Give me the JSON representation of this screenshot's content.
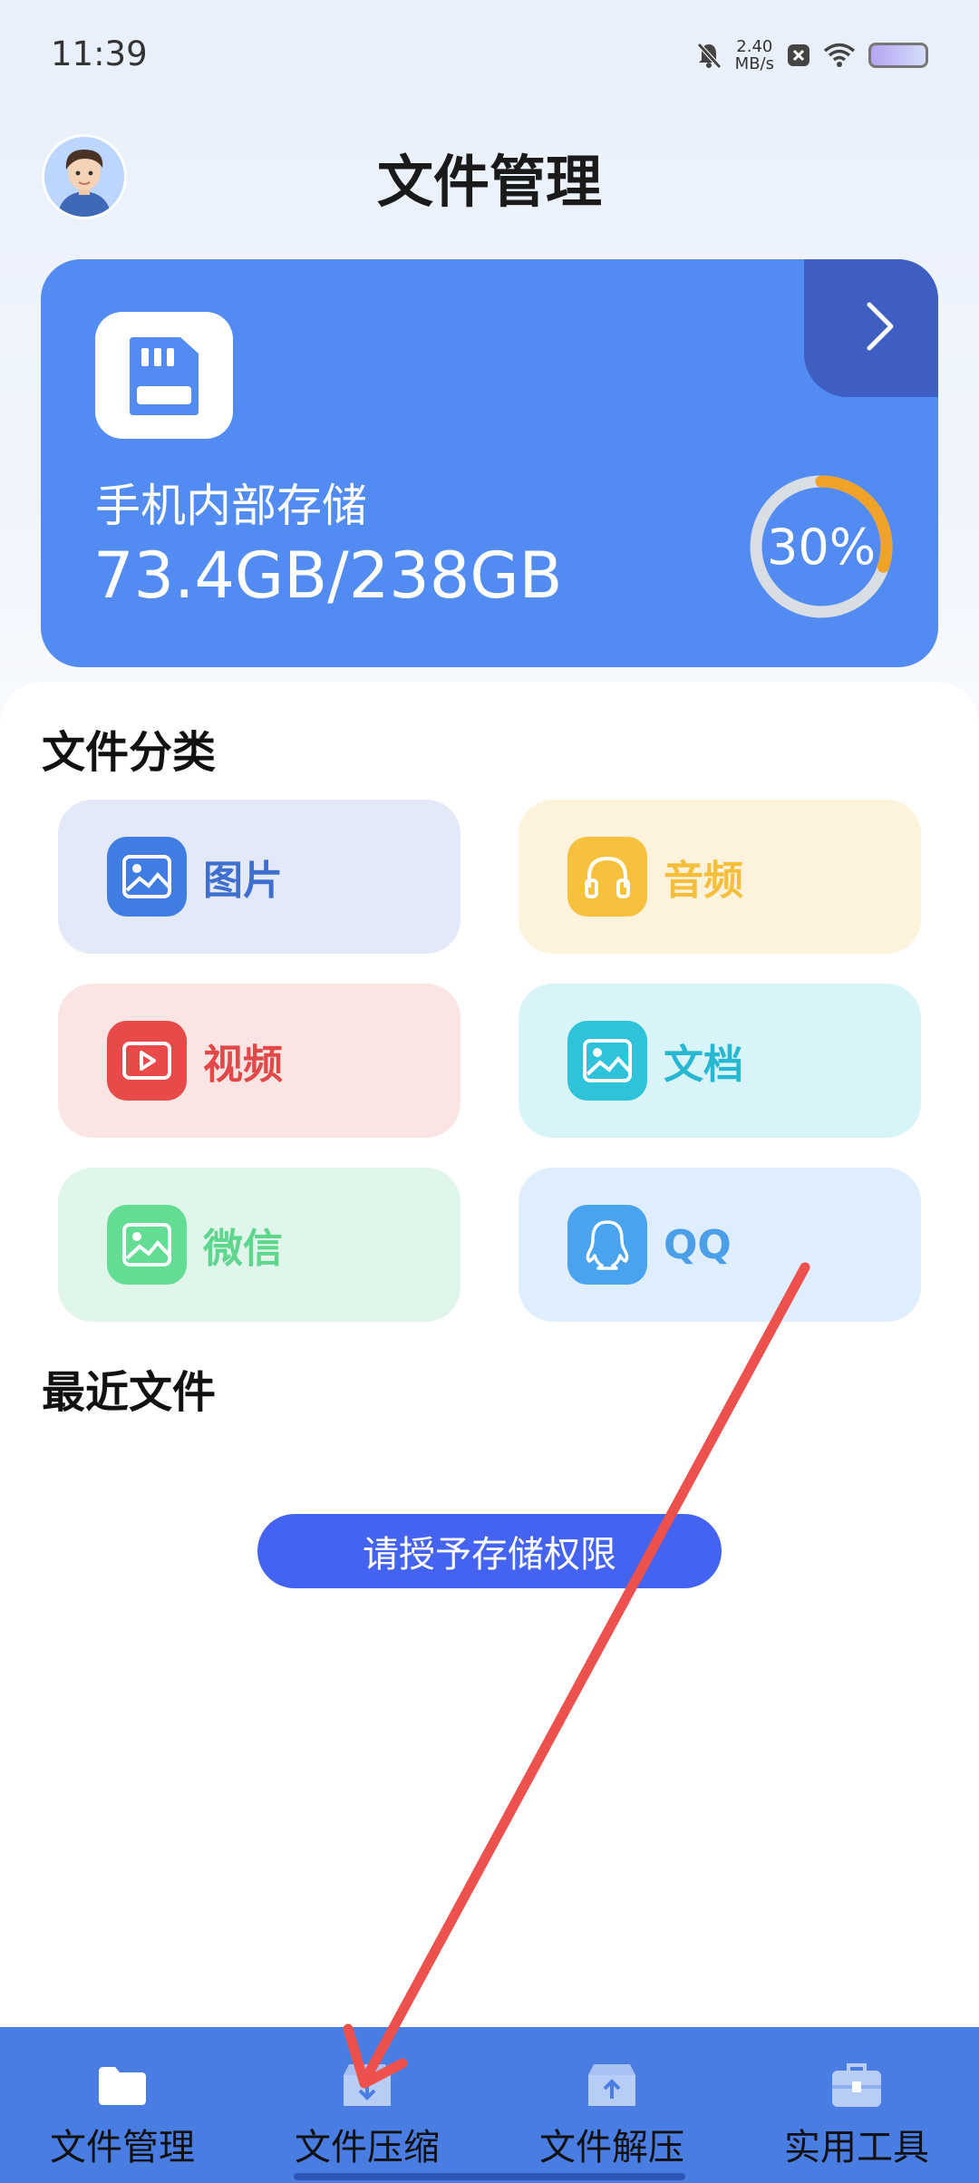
{
  "status_bar": {
    "time": "11:39",
    "net_speed_value": "2.40",
    "net_speed_unit": "MB/s",
    "icons": [
      "mute-bell-icon",
      "close-box-icon",
      "wifi-icon",
      "battery-icon"
    ]
  },
  "header": {
    "title": "文件管理",
    "avatar_icon": "user-avatar"
  },
  "storage": {
    "label": "手机内部存储",
    "usage": "73.4GB/238GB",
    "percent_text": "30%",
    "percent_value": 0.3,
    "card_color": "#528cf3",
    "accent_color": "#f0a229"
  },
  "categories_section": {
    "title": "文件分类",
    "items": [
      {
        "label": "图片",
        "icon": "image-icon",
        "color": "#3f7de2",
        "bg": "#e3e9f8"
      },
      {
        "label": "音频",
        "icon": "headphones-icon",
        "color": "#f7c13d",
        "bg": "#fdf2dc"
      },
      {
        "label": "视频",
        "icon": "video-play-icon",
        "color": "#e84a4a",
        "bg": "#fbe4e4"
      },
      {
        "label": "文档",
        "icon": "document-icon",
        "color": "#2ec3db",
        "bg": "#d8f4f8"
      },
      {
        "label": "微信",
        "icon": "wechat-image-icon",
        "color": "#62dd93",
        "bg": "#e0f6ea"
      },
      {
        "label": "QQ",
        "icon": "qq-penguin-icon",
        "color": "#4aa3ee",
        "bg": "#deeefc"
      }
    ]
  },
  "recent_section": {
    "title": "最近文件"
  },
  "permission_button": {
    "label": "请授予存储权限"
  },
  "bottom_nav": {
    "items": [
      {
        "label": "文件管理",
        "icon": "folder-icon"
      },
      {
        "label": "文件压缩",
        "icon": "archive-download-icon"
      },
      {
        "label": "文件解压",
        "icon": "archive-upload-icon"
      },
      {
        "label": "实用工具",
        "icon": "toolbox-icon"
      }
    ]
  }
}
